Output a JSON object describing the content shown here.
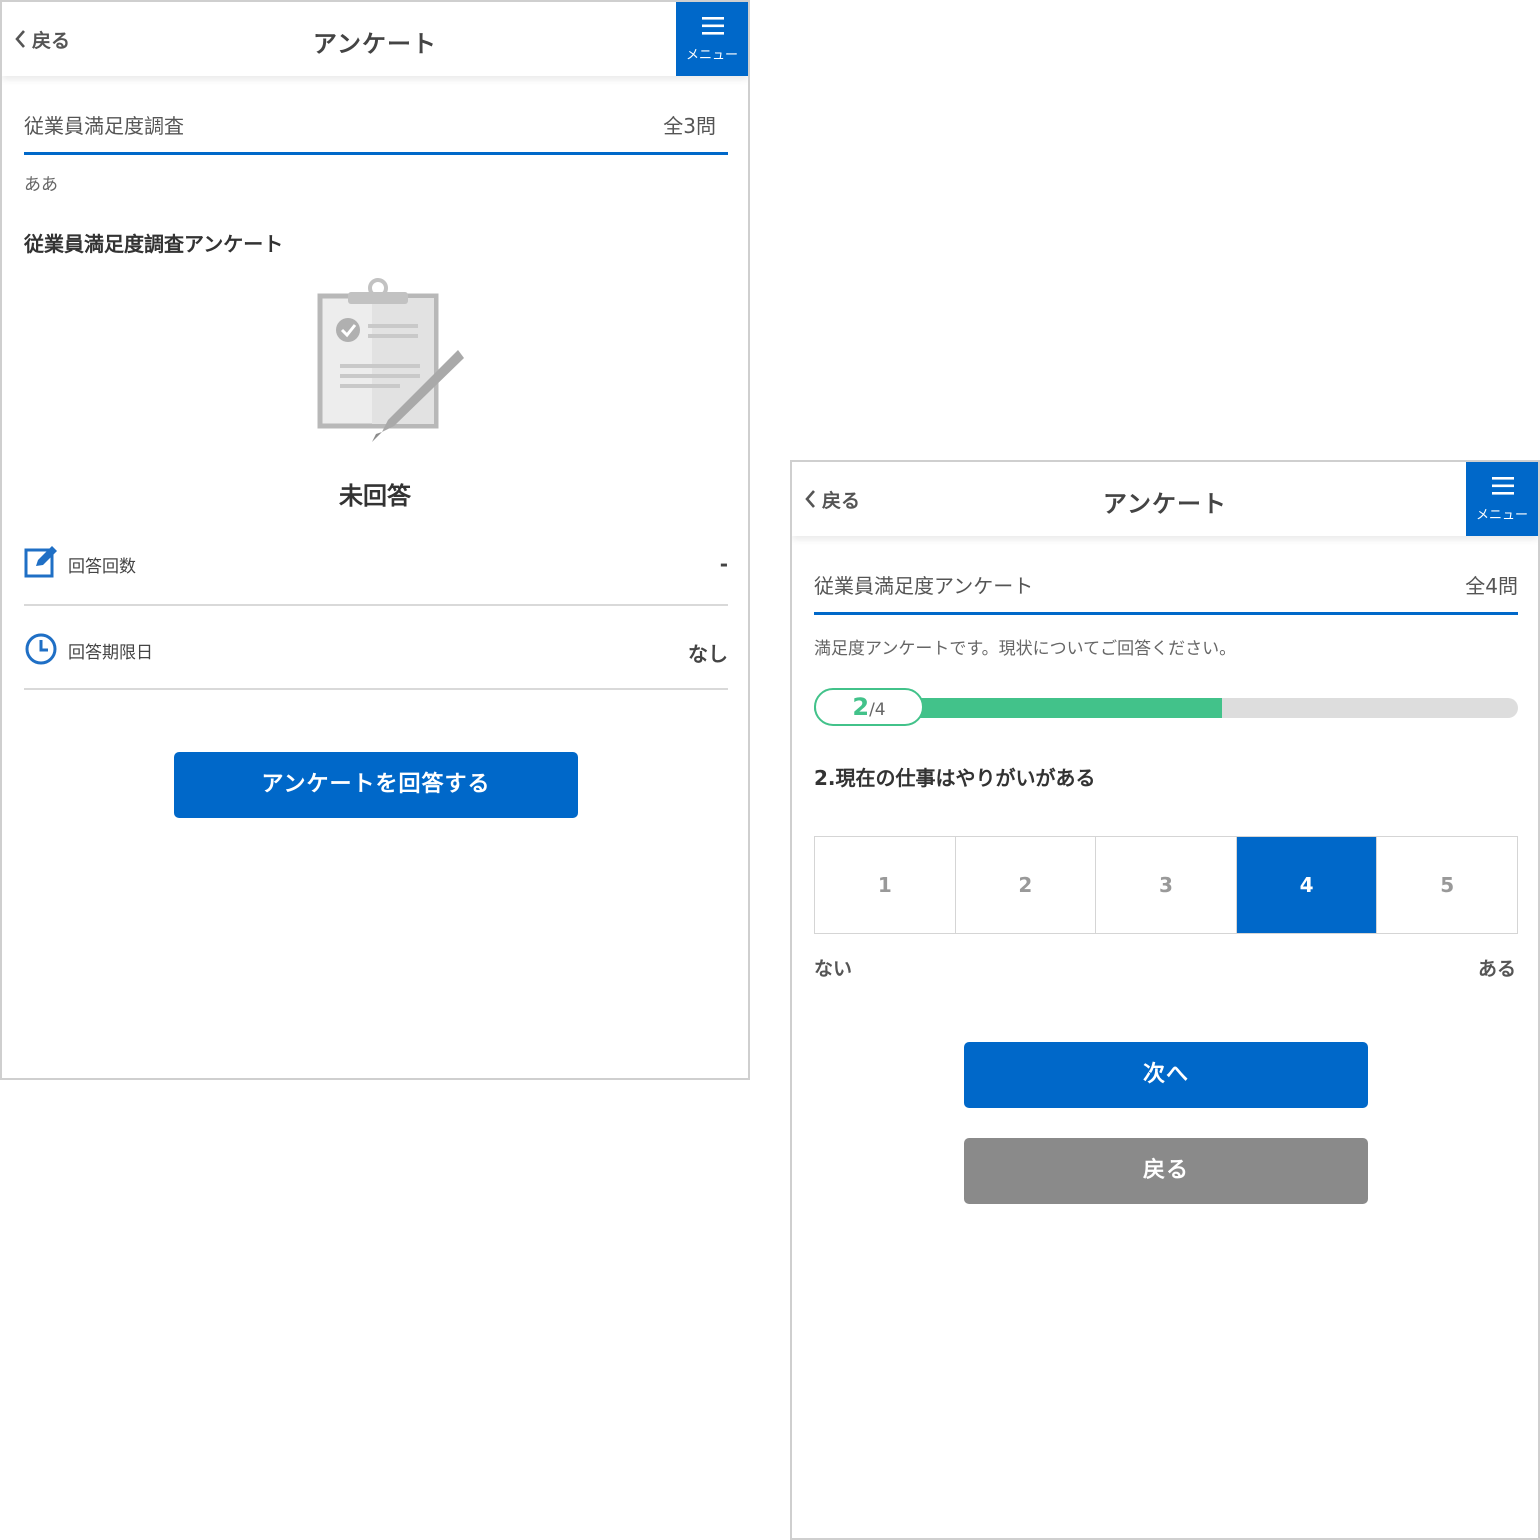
{
  "screen1": {
    "header": {
      "back_label": "戻る",
      "title": "アンケート",
      "menu_label": "メニュー"
    },
    "survey": {
      "name": "従業員満足度調査",
      "count": "全3問"
    },
    "description": "ああ",
    "subtitle": "従業員満足度調査アンケート",
    "status": "未回答",
    "info": [
      {
        "label": "回答回数",
        "value": "-",
        "icon": "edit-icon"
      },
      {
        "label": "回答期限日",
        "value": "なし",
        "icon": "clock-icon"
      }
    ],
    "answer_button": "アンケートを回答する"
  },
  "screen2": {
    "header": {
      "back_label": "戻る",
      "title": "アンケート",
      "menu_label": "メニュー"
    },
    "survey": {
      "name": "従業員満足度アンケート",
      "count": "全4問"
    },
    "description": "満足度アンケートです。現状についてご回答ください。",
    "progress": {
      "current": "2",
      "total": "/4",
      "fraction": 0.58
    },
    "question": "2.現在の仕事はやりがいがある",
    "scale": {
      "options": [
        "1",
        "2",
        "3",
        "4",
        "5"
      ],
      "selected": "4",
      "min_label": "ない",
      "max_label": "ある"
    },
    "next_button": "次へ",
    "back_button": "戻る"
  },
  "colors": {
    "accent": "#0068c9",
    "progress": "#42c28a",
    "secondary": "#8a8a8a"
  }
}
